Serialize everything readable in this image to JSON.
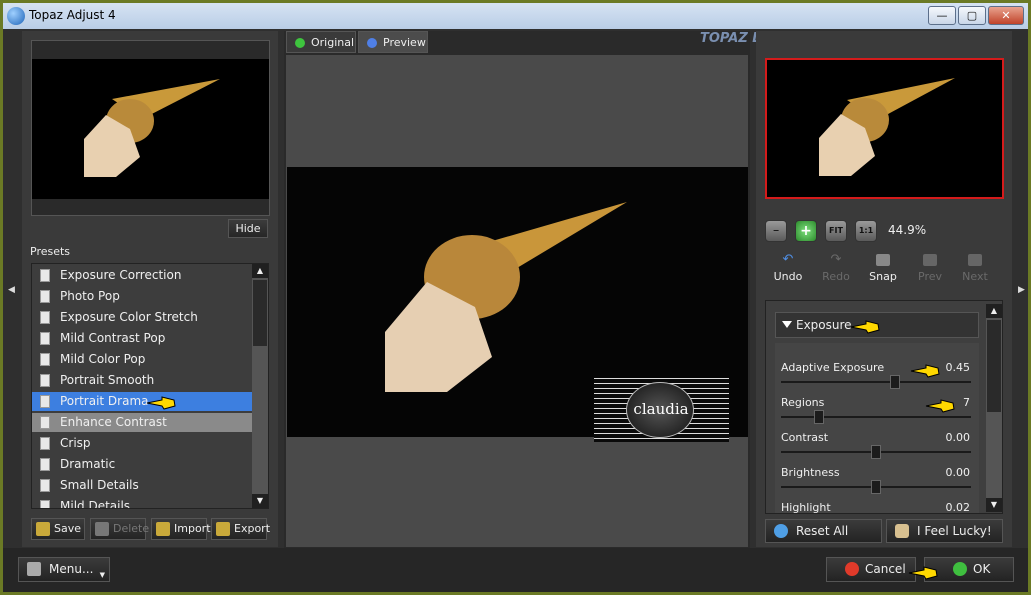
{
  "window": {
    "title": "Topaz Adjust 4",
    "btn_min": "—",
    "btn_max": "▢",
    "btn_close": "✕"
  },
  "left": {
    "hide_label": "Hide",
    "presets_label": "Presets",
    "presets": [
      "Exposure Correction",
      "Photo Pop",
      "Exposure Color Stretch",
      "Mild Contrast Pop",
      "Mild Color Pop",
      "Portrait Smooth",
      "Portrait Drama",
      "Enhance Contrast",
      "Crisp",
      "Dramatic",
      "Small Details",
      "Mild Details"
    ],
    "selected_preset": "Portrait Drama",
    "save_label": "Save",
    "delete_label": "Delete",
    "import_label": "Import",
    "export_label": "Export"
  },
  "center": {
    "tab_original": "Original",
    "tab_preview": "Preview",
    "logo": "TOPAZ LABS",
    "watermark": "claudia"
  },
  "right": {
    "zoom_fit": "FIT",
    "zoom_one": "1:1",
    "zoom_value": "44.9%",
    "undo": "Undo",
    "redo": "Redo",
    "snap": "Snap",
    "prev": "Prev",
    "next": "Next",
    "section": "Exposure",
    "sliders": [
      {
        "label": "Adaptive Exposure",
        "value": "0.45",
        "pos": 0.6
      },
      {
        "label": "Regions",
        "value": "7",
        "pos": 0.2
      },
      {
        "label": "Contrast",
        "value": "0.00",
        "pos": 0.5
      },
      {
        "label": "Brightness",
        "value": "0.00",
        "pos": 0.5
      },
      {
        "label": "Highlight",
        "value": "0.02",
        "pos": 0.5
      }
    ],
    "reset_label": "Reset All",
    "lucky_label": "I Feel Lucky!"
  },
  "footer": {
    "menu_label": "Menu...",
    "cancel_label": "Cancel",
    "ok_label": "OK"
  }
}
